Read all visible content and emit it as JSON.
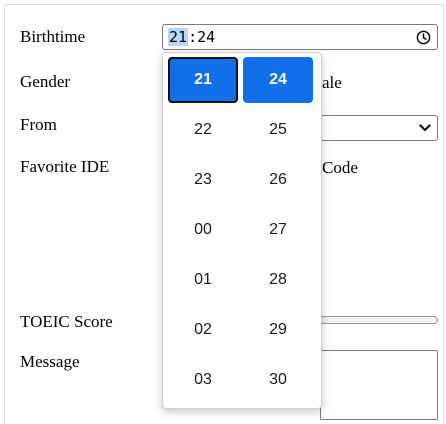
{
  "form": {
    "labels": {
      "birthtime": "Birthtime",
      "gender": "Gender",
      "from": "From",
      "favorite_ide": "Favorite IDE",
      "toeic_score": "TOEIC Score",
      "message": "Message"
    },
    "birthtime": {
      "hours": "21",
      "minutes": "24",
      "separator": ":"
    },
    "gender_partial_text": "ale",
    "ide_partial_text": "Code"
  },
  "picker": {
    "hours": [
      "21",
      "22",
      "23",
      "00",
      "01",
      "02",
      "03"
    ],
    "minutes": [
      "24",
      "25",
      "26",
      "27",
      "28",
      "29",
      "30"
    ],
    "selected_hour": "21",
    "selected_minute": "24"
  },
  "colors": {
    "accent": "#0f70ea",
    "hour_highlight": "#b9d6f7"
  },
  "icons": {
    "time": "clock-icon",
    "select": "chevron-down-icon"
  }
}
